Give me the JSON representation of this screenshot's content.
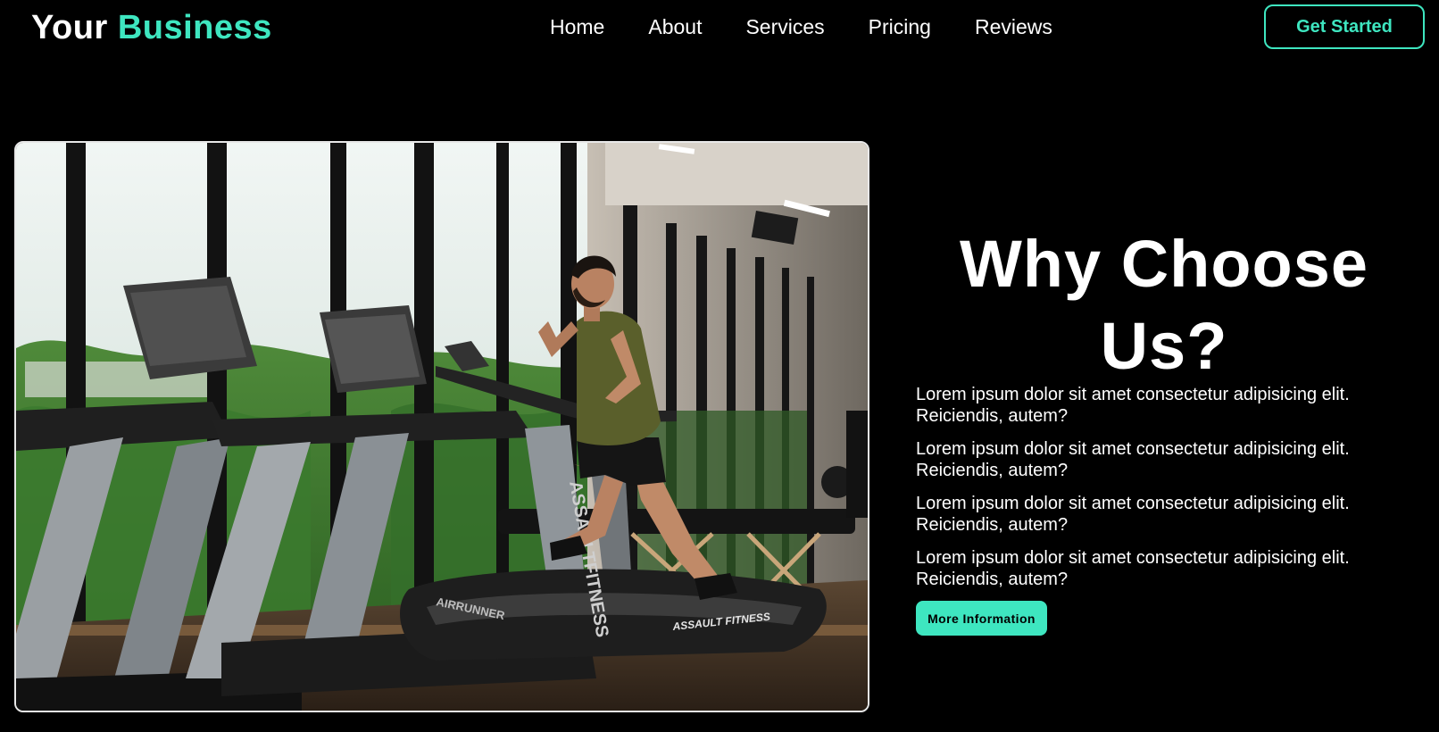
{
  "brand": {
    "word1": "Your",
    "word2": "Business",
    "accent_color": "#3ee6c0"
  },
  "nav": {
    "items": [
      {
        "label": "Home"
      },
      {
        "label": "About"
      },
      {
        "label": "Services"
      },
      {
        "label": "Pricing"
      },
      {
        "label": "Reviews"
      }
    ],
    "cta_label": "Get Started"
  },
  "hero": {
    "image": "gym-treadmill-photo",
    "heading": "Why Choose Us?",
    "points": [
      "Lorem ipsum dolor sit amet consectetur adipisicing elit. Reiciendis, autem?",
      "Lorem ipsum dolor sit amet consectetur adipisicing elit. Reiciendis, autem?",
      "Lorem ipsum dolor sit amet consectetur adipisicing elit. Reiciendis, autem?",
      "Lorem ipsum dolor sit amet consectetur adipisicing elit. Reiciendis, autem?"
    ],
    "button_label": "More Information",
    "treadmill_brand": "ASSAULTFITNESS",
    "treadmill_model": "AIRRUNNER",
    "treadmill_base_logo": "ASSAULT FITNESS"
  }
}
